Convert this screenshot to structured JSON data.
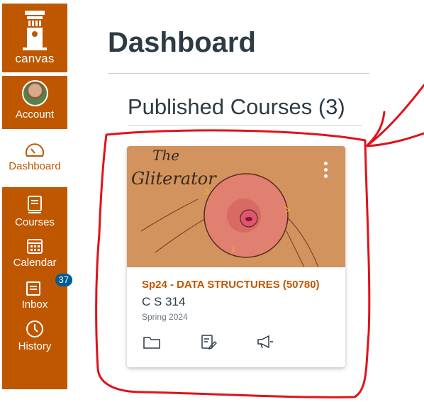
{
  "sidebar": {
    "logo_label": "canvas",
    "items": [
      {
        "label": "Account",
        "icon": "avatar"
      },
      {
        "label": "Dashboard",
        "icon": "dashboard-icon",
        "active": true
      },
      {
        "label": "Courses",
        "icon": "book-icon"
      },
      {
        "label": "Calendar",
        "icon": "calendar-icon"
      },
      {
        "label": "Inbox",
        "icon": "inbox-icon",
        "badge": "37"
      },
      {
        "label": "History",
        "icon": "clock-icon"
      }
    ]
  },
  "main": {
    "title": "Dashboard",
    "section_title": "Published Courses (3)",
    "course_card": {
      "hero_text": [
        "The",
        "Gliterator"
      ],
      "name": "Sp24 - DATA STRUCTURES (50780)",
      "code": "C S 314",
      "term": "Spring 2024"
    }
  },
  "colors": {
    "brand": "#bf5700",
    "hero": "#d2935e",
    "annotation": "#e0121b",
    "badge": "#005b96"
  }
}
